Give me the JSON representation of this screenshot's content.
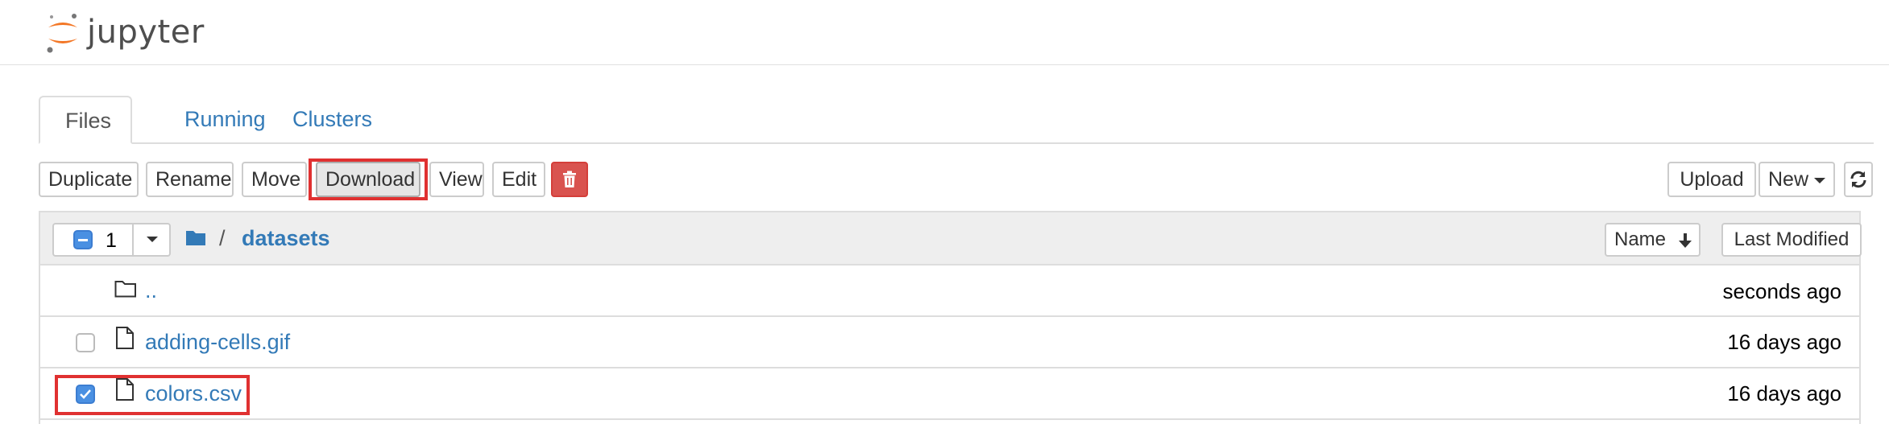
{
  "header": {
    "logo_text": "jupyter"
  },
  "tabs": [
    {
      "label": "Files"
    },
    {
      "label": "Running"
    },
    {
      "label": "Clusters"
    }
  ],
  "toolbar": {
    "duplicate": "Duplicate",
    "rename": "Rename",
    "move": "Move",
    "download": "Download",
    "view": "View",
    "edit": "Edit",
    "upload": "Upload",
    "new": "New"
  },
  "list_header": {
    "selected_count": "1",
    "breadcrumb_sep": "/",
    "folder": "datasets",
    "sort_name": "Name",
    "sort_modified": "Last Modified"
  },
  "rows": [
    {
      "name": "..",
      "modified": "seconds ago",
      "checked": false
    },
    {
      "name": "adding-cells.gif",
      "modified": "16 days ago",
      "checked": false
    },
    {
      "name": "colors.csv",
      "modified": "16 days ago",
      "checked": true
    }
  ],
  "colors": {
    "accent": "#337ab7",
    "danger": "#d9534f",
    "highlight": "#e03131",
    "checkbox": "#4a90e2"
  }
}
